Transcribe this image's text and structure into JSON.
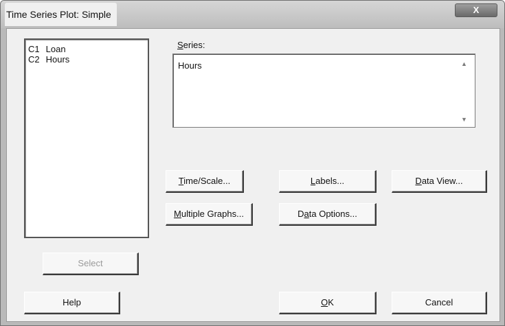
{
  "window": {
    "title": "Time Series Plot: Simple",
    "close_glyph": "X"
  },
  "column_list": {
    "items": [
      {
        "col": "C1",
        "name": "Loan"
      },
      {
        "col": "C2",
        "name": "Hours"
      }
    ]
  },
  "series": {
    "label_mnemonic": "S",
    "label_rest": "eries:",
    "value": "Hours"
  },
  "buttons": {
    "time_scale": {
      "mnemonic": "T",
      "rest": "ime/Scale..."
    },
    "labels": {
      "mnemonic": "L",
      "rest": "abels..."
    },
    "data_view": {
      "mnemonic": "D",
      "rest": "ata View..."
    },
    "multiple_graphs": {
      "mnemonic": "M",
      "rest": "ultiple Graphs..."
    },
    "data_options": {
      "pre": "D",
      "mnemonic": "a",
      "rest": "ta Options..."
    },
    "select": "Select",
    "help": "Help",
    "ok": {
      "mnemonic": "O",
      "rest": "K"
    },
    "cancel": "Cancel"
  }
}
